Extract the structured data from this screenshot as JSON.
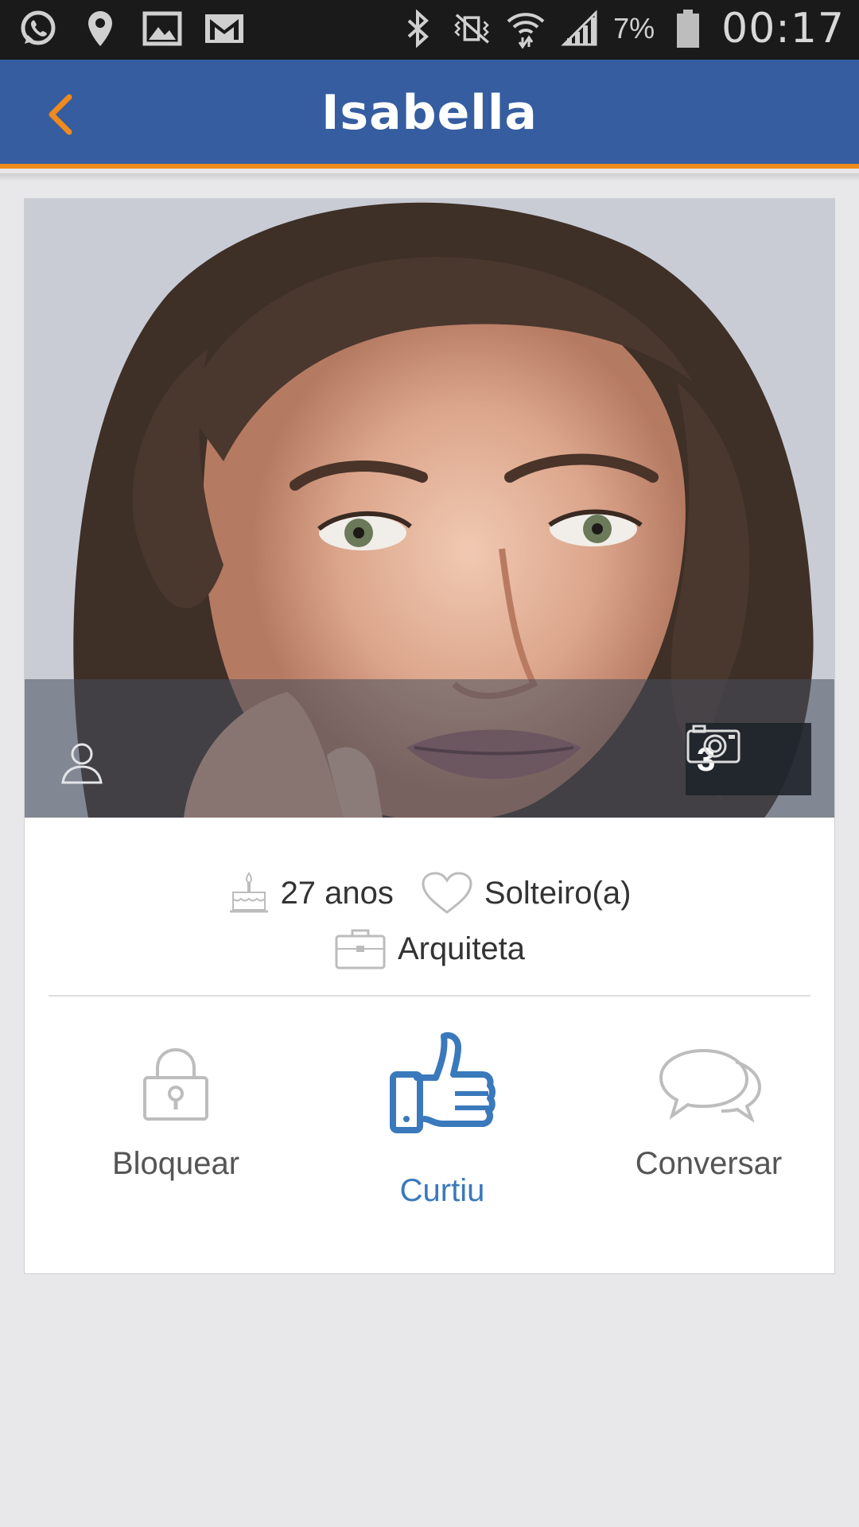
{
  "status_bar": {
    "battery": "7%",
    "time": "00:17",
    "left_icons": [
      "whatsapp-icon",
      "location-pin-icon",
      "image-icon",
      "gmail-icon"
    ],
    "right_icons": [
      "bluetooth-icon",
      "vibrate-icon",
      "wifi-icon",
      "signal-icon",
      "battery-icon"
    ]
  },
  "appbar": {
    "title": "Isabella",
    "back_icon": "chevron-left-icon",
    "colors": {
      "background": "#355da0",
      "accent": "#f08a1c"
    }
  },
  "photo": {
    "count": "3",
    "count_icon": "camera-icon",
    "profile_icon": "person-icon"
  },
  "info": {
    "age": "27 anos",
    "status": "Solteiro(a)",
    "occupation": "Arquiteta"
  },
  "actions": {
    "block": "Bloquear",
    "like": "Curtiu",
    "chat": "Conversar",
    "like_color": "#3a79bb"
  }
}
